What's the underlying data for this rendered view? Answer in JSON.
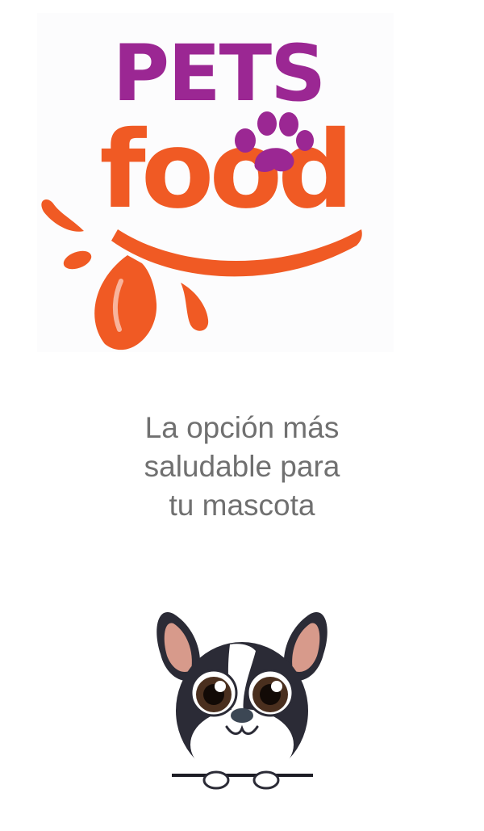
{
  "splash": {
    "logo": {
      "word_top": "PETS",
      "word_bottom": "food",
      "colors": {
        "purple": "#9b2793",
        "orange": "#f05a24"
      }
    },
    "tagline": {
      "line1": "La opción más",
      "line2": "saludable para",
      "line3": "tu mascota",
      "color": "#707070"
    },
    "mascot_icon": "cartoon-dog-icon"
  }
}
